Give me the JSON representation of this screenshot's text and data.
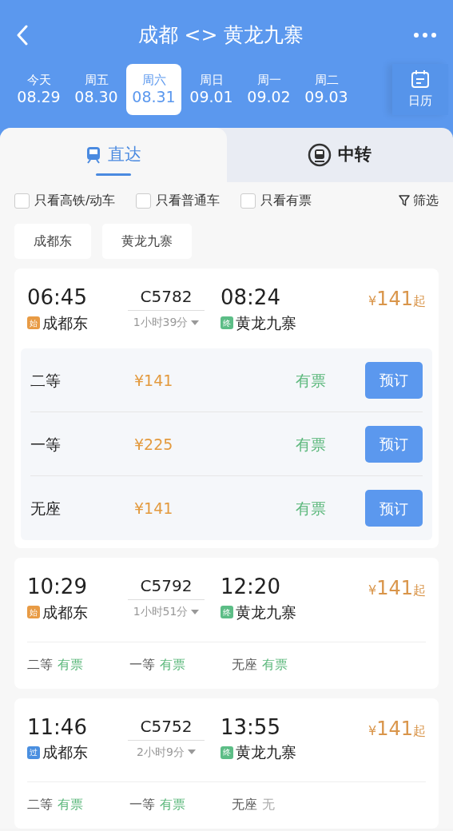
{
  "header": {
    "title": "成都 <> 黄龙九寨"
  },
  "dates": [
    {
      "weekday": "今天",
      "date": "08.29",
      "selected": false
    },
    {
      "weekday": "周五",
      "date": "08.30",
      "selected": false
    },
    {
      "weekday": "周六",
      "date": "08.31",
      "selected": true
    },
    {
      "weekday": "周日",
      "date": "09.01",
      "selected": false
    },
    {
      "weekday": "周一",
      "date": "09.02",
      "selected": false
    },
    {
      "weekday": "周二",
      "date": "09.03",
      "selected": false
    }
  ],
  "calendar_label": "日历",
  "tabs": [
    {
      "label": "直达",
      "kind": "direct",
      "selected": true
    },
    {
      "label": "中转",
      "kind": "transfer",
      "selected": false
    }
  ],
  "filters": [
    {
      "label": "只看高铁/动车",
      "checked": false
    },
    {
      "label": "只看普通车",
      "checked": false
    },
    {
      "label": "只看有票",
      "checked": false
    }
  ],
  "filter_button": "筛选",
  "stations": [
    "成都东",
    "黄龙九寨"
  ],
  "trains": [
    {
      "depart_time": "06:45",
      "depart_tag": {
        "label": "始",
        "color": "#e89b45"
      },
      "depart_station": "成都东",
      "train_no": "C5782",
      "duration": "1小时39分",
      "arrive_time": "08:24",
      "arrive_tag": {
        "label": "终",
        "color": "#5cbd86"
      },
      "arrive_station": "黄龙九寨",
      "price": {
        "currency": "¥",
        "amount": "141",
        "suffix": "起"
      },
      "expanded": true,
      "seats": [
        {
          "class": "二等",
          "price": "¥141",
          "status": "有票",
          "available": true,
          "button": "预订"
        },
        {
          "class": "一等",
          "price": "¥225",
          "status": "有票",
          "available": true,
          "button": "预订"
        },
        {
          "class": "无座",
          "price": "¥141",
          "status": "有票",
          "available": true,
          "button": "预订"
        }
      ]
    },
    {
      "depart_time": "10:29",
      "depart_tag": {
        "label": "始",
        "color": "#e89b45"
      },
      "depart_station": "成都东",
      "train_no": "C5792",
      "duration": "1小时51分",
      "arrive_time": "12:20",
      "arrive_tag": {
        "label": "终",
        "color": "#5cbd86"
      },
      "arrive_station": "黄龙九寨",
      "price": {
        "currency": "¥",
        "amount": "141",
        "suffix": "起"
      },
      "expanded": false,
      "seats": [
        {
          "class": "二等",
          "status": "有票",
          "available": true
        },
        {
          "class": "一等",
          "status": "有票",
          "available": true
        },
        {
          "class": "无座",
          "status": "有票",
          "available": true
        }
      ]
    },
    {
      "depart_time": "11:46",
      "depart_tag": {
        "label": "过",
        "color": "#4a8fe0"
      },
      "depart_station": "成都东",
      "train_no": "C5752",
      "duration": "2小时9分",
      "arrive_time": "13:55",
      "arrive_tag": {
        "label": "终",
        "color": "#5cbd86"
      },
      "arrive_station": "黄龙九寨",
      "price": {
        "currency": "¥",
        "amount": "141",
        "suffix": "起"
      },
      "expanded": false,
      "seats": [
        {
          "class": "二等",
          "status": "有票",
          "available": true
        },
        {
          "class": "一等",
          "status": "有票",
          "available": true
        },
        {
          "class": "无座",
          "status": "无",
          "available": false
        }
      ]
    }
  ]
}
